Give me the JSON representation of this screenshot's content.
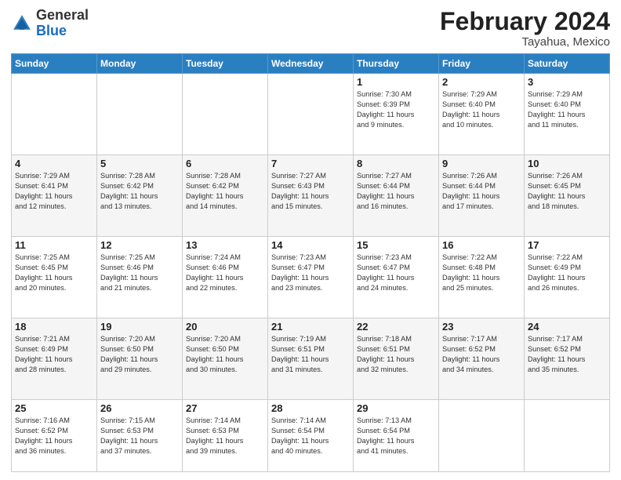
{
  "header": {
    "logo_general": "General",
    "logo_blue": "Blue",
    "month_year": "February 2024",
    "location": "Tayahua, Mexico"
  },
  "weekdays": [
    "Sunday",
    "Monday",
    "Tuesday",
    "Wednesday",
    "Thursday",
    "Friday",
    "Saturday"
  ],
  "weeks": [
    [
      {
        "day": "",
        "info": ""
      },
      {
        "day": "",
        "info": ""
      },
      {
        "day": "",
        "info": ""
      },
      {
        "day": "",
        "info": ""
      },
      {
        "day": "1",
        "info": "Sunrise: 7:30 AM\nSunset: 6:39 PM\nDaylight: 11 hours\nand 9 minutes."
      },
      {
        "day": "2",
        "info": "Sunrise: 7:29 AM\nSunset: 6:40 PM\nDaylight: 11 hours\nand 10 minutes."
      },
      {
        "day": "3",
        "info": "Sunrise: 7:29 AM\nSunset: 6:40 PM\nDaylight: 11 hours\nand 11 minutes."
      }
    ],
    [
      {
        "day": "4",
        "info": "Sunrise: 7:29 AM\nSunset: 6:41 PM\nDaylight: 11 hours\nand 12 minutes."
      },
      {
        "day": "5",
        "info": "Sunrise: 7:28 AM\nSunset: 6:42 PM\nDaylight: 11 hours\nand 13 minutes."
      },
      {
        "day": "6",
        "info": "Sunrise: 7:28 AM\nSunset: 6:42 PM\nDaylight: 11 hours\nand 14 minutes."
      },
      {
        "day": "7",
        "info": "Sunrise: 7:27 AM\nSunset: 6:43 PM\nDaylight: 11 hours\nand 15 minutes."
      },
      {
        "day": "8",
        "info": "Sunrise: 7:27 AM\nSunset: 6:44 PM\nDaylight: 11 hours\nand 16 minutes."
      },
      {
        "day": "9",
        "info": "Sunrise: 7:26 AM\nSunset: 6:44 PM\nDaylight: 11 hours\nand 17 minutes."
      },
      {
        "day": "10",
        "info": "Sunrise: 7:26 AM\nSunset: 6:45 PM\nDaylight: 11 hours\nand 18 minutes."
      }
    ],
    [
      {
        "day": "11",
        "info": "Sunrise: 7:25 AM\nSunset: 6:45 PM\nDaylight: 11 hours\nand 20 minutes."
      },
      {
        "day": "12",
        "info": "Sunrise: 7:25 AM\nSunset: 6:46 PM\nDaylight: 11 hours\nand 21 minutes."
      },
      {
        "day": "13",
        "info": "Sunrise: 7:24 AM\nSunset: 6:46 PM\nDaylight: 11 hours\nand 22 minutes."
      },
      {
        "day": "14",
        "info": "Sunrise: 7:23 AM\nSunset: 6:47 PM\nDaylight: 11 hours\nand 23 minutes."
      },
      {
        "day": "15",
        "info": "Sunrise: 7:23 AM\nSunset: 6:47 PM\nDaylight: 11 hours\nand 24 minutes."
      },
      {
        "day": "16",
        "info": "Sunrise: 7:22 AM\nSunset: 6:48 PM\nDaylight: 11 hours\nand 25 minutes."
      },
      {
        "day": "17",
        "info": "Sunrise: 7:22 AM\nSunset: 6:49 PM\nDaylight: 11 hours\nand 26 minutes."
      }
    ],
    [
      {
        "day": "18",
        "info": "Sunrise: 7:21 AM\nSunset: 6:49 PM\nDaylight: 11 hours\nand 28 minutes."
      },
      {
        "day": "19",
        "info": "Sunrise: 7:20 AM\nSunset: 6:50 PM\nDaylight: 11 hours\nand 29 minutes."
      },
      {
        "day": "20",
        "info": "Sunrise: 7:20 AM\nSunset: 6:50 PM\nDaylight: 11 hours\nand 30 minutes."
      },
      {
        "day": "21",
        "info": "Sunrise: 7:19 AM\nSunset: 6:51 PM\nDaylight: 11 hours\nand 31 minutes."
      },
      {
        "day": "22",
        "info": "Sunrise: 7:18 AM\nSunset: 6:51 PM\nDaylight: 11 hours\nand 32 minutes."
      },
      {
        "day": "23",
        "info": "Sunrise: 7:17 AM\nSunset: 6:52 PM\nDaylight: 11 hours\nand 34 minutes."
      },
      {
        "day": "24",
        "info": "Sunrise: 7:17 AM\nSunset: 6:52 PM\nDaylight: 11 hours\nand 35 minutes."
      }
    ],
    [
      {
        "day": "25",
        "info": "Sunrise: 7:16 AM\nSunset: 6:52 PM\nDaylight: 11 hours\nand 36 minutes."
      },
      {
        "day": "26",
        "info": "Sunrise: 7:15 AM\nSunset: 6:53 PM\nDaylight: 11 hours\nand 37 minutes."
      },
      {
        "day": "27",
        "info": "Sunrise: 7:14 AM\nSunset: 6:53 PM\nDaylight: 11 hours\nand 39 minutes."
      },
      {
        "day": "28",
        "info": "Sunrise: 7:14 AM\nSunset: 6:54 PM\nDaylight: 11 hours\nand 40 minutes."
      },
      {
        "day": "29",
        "info": "Sunrise: 7:13 AM\nSunset: 6:54 PM\nDaylight: 11 hours\nand 41 minutes."
      },
      {
        "day": "",
        "info": ""
      },
      {
        "day": "",
        "info": ""
      }
    ]
  ]
}
